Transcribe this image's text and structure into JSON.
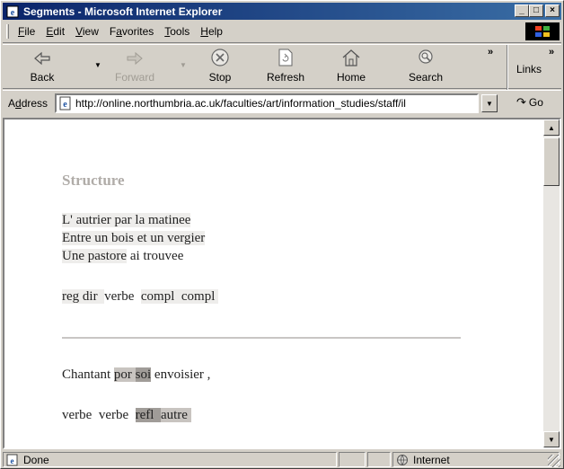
{
  "window": {
    "title": "Segments - Microsoft Internet Explorer",
    "controls": {
      "minimize": "_",
      "maximize": "□",
      "close": "×"
    }
  },
  "menu": {
    "items": [
      {
        "label": "File",
        "mnemonic": "F",
        "rest": "ile"
      },
      {
        "label": "Edit",
        "mnemonic": "E",
        "rest": "dit"
      },
      {
        "label": "View",
        "mnemonic": "V",
        "rest": "iew"
      },
      {
        "label": "Favorites",
        "pre": "F",
        "mnemonic": "a",
        "rest": "vorites"
      },
      {
        "label": "Tools",
        "mnemonic": "T",
        "rest": "ools"
      },
      {
        "label": "Help",
        "mnemonic": "H",
        "rest": "elp"
      }
    ]
  },
  "toolbar": {
    "back": "Back",
    "forward": "Forward",
    "stop": "Stop",
    "refresh": "Refresh",
    "home": "Home",
    "search": "Search",
    "chevron": "»",
    "links_chevron": "»",
    "links": "Links"
  },
  "address": {
    "label_mnemonic": "d",
    "label_pre": "A",
    "label_rest": "dress",
    "url": "http://online.northumbria.ac.uk/faculties/art/information_studies/staff/il",
    "go": "Go"
  },
  "page": {
    "heading": "Structure",
    "verse1": [
      "L' autrier par la matinee",
      "Entre un bois et un vergier",
      "Une pastore ai trouvee"
    ],
    "verse1_line3": {
      "highlighted": "Une pastore",
      "plain": " ai trouvee"
    },
    "tags1": [
      "reg dir",
      "verbe",
      "compl",
      "compl"
    ],
    "verse2": {
      "pre": "Chantant ",
      "por": "por",
      "soi": "soi",
      "post": " envoisier ,"
    },
    "tags2": [
      "verbe",
      "verbe",
      "refl",
      "autre"
    ]
  },
  "status": {
    "text": "Done",
    "zone": "Internet"
  },
  "colors": {
    "titlebar_start": "#0a246a",
    "titlebar_end": "#3a6ea5",
    "chrome": "#d4d0c8",
    "heading": "#b0aca8"
  }
}
